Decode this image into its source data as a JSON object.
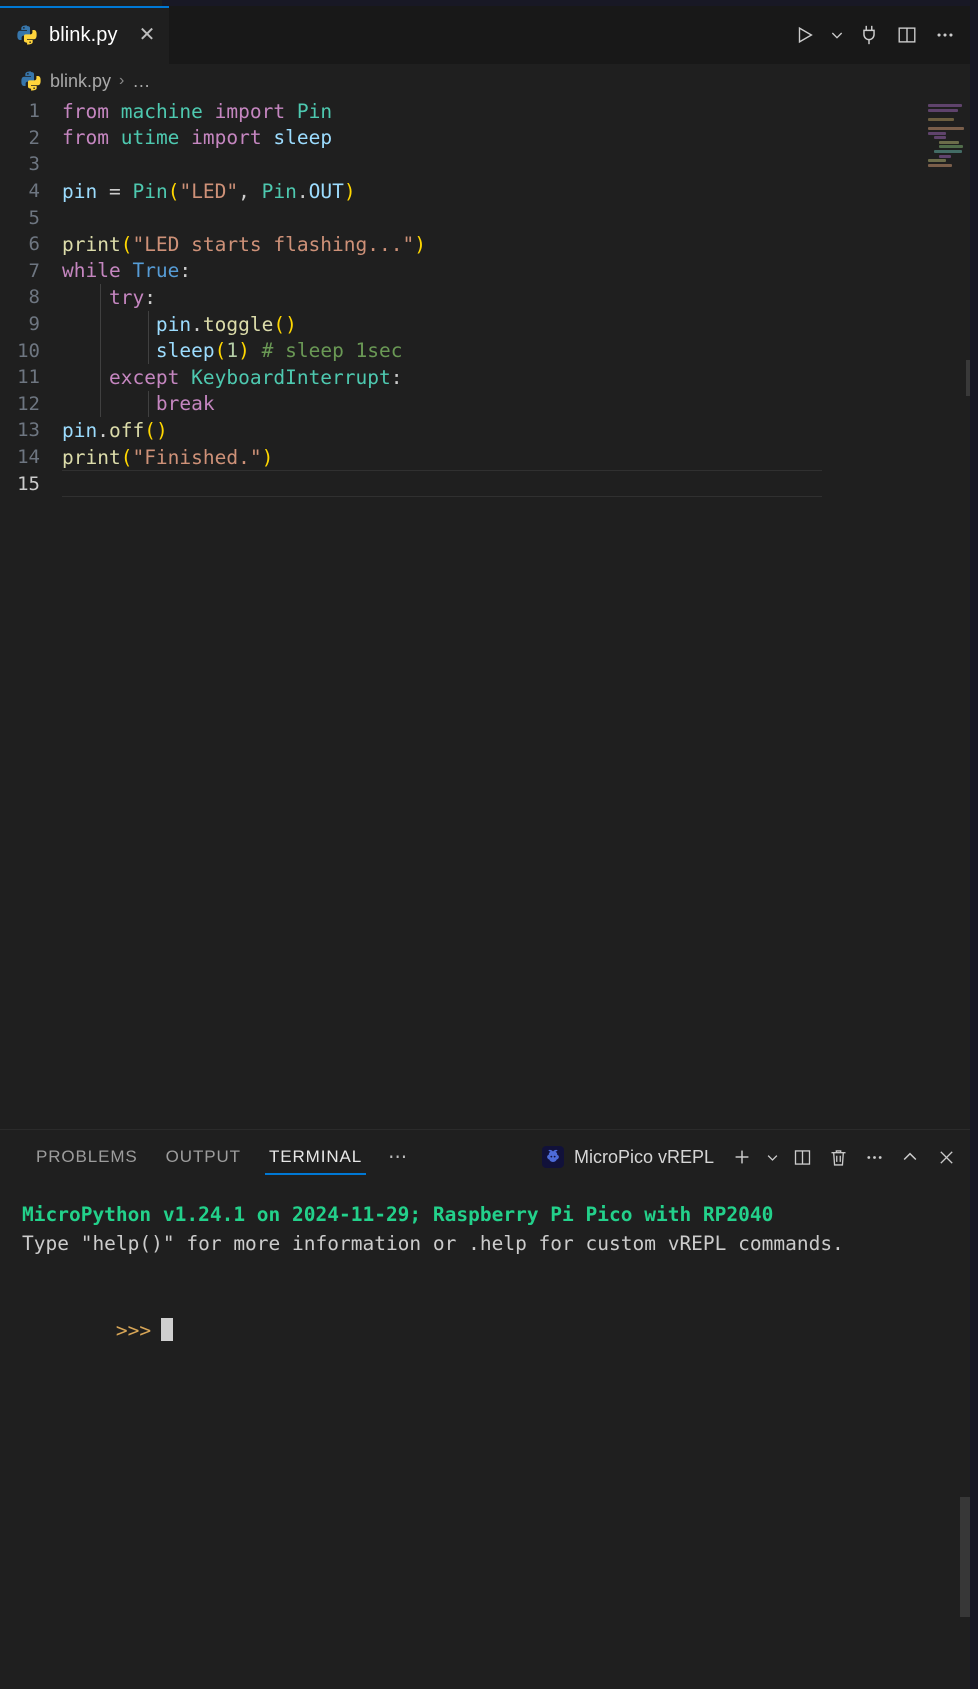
{
  "window": {
    "tab": {
      "title": "blink.py",
      "icon": "python-icon",
      "close_icon": "close-icon"
    },
    "actions": [
      {
        "name": "run-python-file-button",
        "icon": "play-icon",
        "label": "Run Python File"
      },
      {
        "name": "run-options-chevron",
        "icon": "chevron-down-icon",
        "label": ""
      },
      {
        "name": "micropico-connect-button",
        "icon": "plug-icon",
        "label": ""
      },
      {
        "name": "split-editor-button",
        "icon": "split-editor-icon",
        "label": ""
      },
      {
        "name": "more-actions-button",
        "icon": "ellipsis-icon",
        "label": "⋯"
      }
    ]
  },
  "breadcrumb": {
    "file": "blink.py",
    "separator": "›",
    "overflow": "…"
  },
  "editor": {
    "language": "python",
    "total_lines": 15,
    "current_line": 15,
    "lines": [
      {
        "n": "1",
        "tokens": [
          {
            "t": "from",
            "c": "kw"
          },
          {
            "t": " ",
            "c": "pun"
          },
          {
            "t": "machine",
            "c": "cls"
          },
          {
            "t": " ",
            "c": "pun"
          },
          {
            "t": "import",
            "c": "kw"
          },
          {
            "t": " ",
            "c": "pun"
          },
          {
            "t": "Pin",
            "c": "cls"
          }
        ]
      },
      {
        "n": "2",
        "tokens": [
          {
            "t": "from",
            "c": "kw"
          },
          {
            "t": " ",
            "c": "pun"
          },
          {
            "t": "utime",
            "c": "cls"
          },
          {
            "t": " ",
            "c": "pun"
          },
          {
            "t": "import",
            "c": "kw"
          },
          {
            "t": " ",
            "c": "pun"
          },
          {
            "t": "sleep",
            "c": "var"
          }
        ]
      },
      {
        "n": "3",
        "tokens": []
      },
      {
        "n": "4",
        "tokens": [
          {
            "t": "pin",
            "c": "var"
          },
          {
            "t": " = ",
            "c": "op"
          },
          {
            "t": "Pin",
            "c": "cls"
          },
          {
            "t": "(",
            "c": "br1"
          },
          {
            "t": "\"LED\"",
            "c": "str"
          },
          {
            "t": ", ",
            "c": "pun"
          },
          {
            "t": "Pin",
            "c": "cls"
          },
          {
            "t": ".",
            "c": "pun"
          },
          {
            "t": "OUT",
            "c": "var"
          },
          {
            "t": ")",
            "c": "br1"
          }
        ]
      },
      {
        "n": "5",
        "tokens": []
      },
      {
        "n": "6",
        "tokens": [
          {
            "t": "print",
            "c": "fn"
          },
          {
            "t": "(",
            "c": "br1"
          },
          {
            "t": "\"LED starts flashing...\"",
            "c": "str"
          },
          {
            "t": ")",
            "c": "br1"
          }
        ]
      },
      {
        "n": "7",
        "tokens": [
          {
            "t": "while",
            "c": "kw"
          },
          {
            "t": " ",
            "c": "pun"
          },
          {
            "t": "True",
            "c": "kw2"
          },
          {
            "t": ":",
            "c": "pun"
          }
        ]
      },
      {
        "n": "8",
        "tokens": [
          {
            "t": "    ",
            "c": "pun"
          },
          {
            "t": "try",
            "c": "kw"
          },
          {
            "t": ":",
            "c": "pun"
          }
        ]
      },
      {
        "n": "9",
        "tokens": [
          {
            "t": "        ",
            "c": "pun"
          },
          {
            "t": "pin",
            "c": "var"
          },
          {
            "t": ".",
            "c": "pun"
          },
          {
            "t": "toggle",
            "c": "fn"
          },
          {
            "t": "()",
            "c": "br1"
          }
        ]
      },
      {
        "n": "10",
        "tokens": [
          {
            "t": "        ",
            "c": "pun"
          },
          {
            "t": "sleep",
            "c": "var"
          },
          {
            "t": "(",
            "c": "br1"
          },
          {
            "t": "1",
            "c": "num"
          },
          {
            "t": ")",
            "c": "br1"
          },
          {
            "t": " ",
            "c": "pun"
          },
          {
            "t": "# sleep 1sec",
            "c": "cmt"
          }
        ]
      },
      {
        "n": "11",
        "tokens": [
          {
            "t": "    ",
            "c": "pun"
          },
          {
            "t": "except",
            "c": "kw"
          },
          {
            "t": " ",
            "c": "pun"
          },
          {
            "t": "KeyboardInterrupt",
            "c": "cls"
          },
          {
            "t": ":",
            "c": "pun"
          }
        ]
      },
      {
        "n": "12",
        "tokens": [
          {
            "t": "        ",
            "c": "pun"
          },
          {
            "t": "break",
            "c": "kw"
          }
        ]
      },
      {
        "n": "13",
        "tokens": [
          {
            "t": "pin",
            "c": "var"
          },
          {
            "t": ".",
            "c": "pun"
          },
          {
            "t": "off",
            "c": "fn"
          },
          {
            "t": "()",
            "c": "br1"
          }
        ]
      },
      {
        "n": "14",
        "tokens": [
          {
            "t": "print",
            "c": "fn"
          },
          {
            "t": "(",
            "c": "br1"
          },
          {
            "t": "\"Finished.\"",
            "c": "str"
          },
          {
            "t": ")",
            "c": "br1"
          }
        ]
      },
      {
        "n": "15",
        "tokens": []
      }
    ]
  },
  "panel": {
    "tabs": [
      {
        "label": "PROBLEMS",
        "active": false
      },
      {
        "label": "OUTPUT",
        "active": false
      },
      {
        "label": "TERMINAL",
        "active": true
      }
    ],
    "overflow": "⋯",
    "terminal_selector": {
      "label": "MicroPico vREPL",
      "icon": "raspberry-pi-icon"
    },
    "actions": [
      {
        "name": "new-terminal-button",
        "icon": "plus-icon"
      },
      {
        "name": "terminal-profile-chevron",
        "icon": "chevron-down-icon"
      },
      {
        "name": "split-terminal-button",
        "icon": "split-editor-icon"
      },
      {
        "name": "kill-terminal-button",
        "icon": "trash-icon"
      },
      {
        "name": "terminal-more-button",
        "icon": "ellipsis-icon"
      },
      {
        "name": "maximize-panel-button",
        "icon": "chevron-up-icon"
      },
      {
        "name": "close-panel-button",
        "icon": "close-icon"
      }
    ]
  },
  "terminal": {
    "banner": "MicroPython v1.24.1 on 2024-11-29; Raspberry Pi Pico with RP2040",
    "help": "Type \"help()\" for more information or .help for custom vREPL commands.",
    "prompt": ">>>",
    "input_value": ""
  },
  "colors": {
    "accent": "#0078d4",
    "editor_bg": "#1f1f1f",
    "tabbar_bg": "#181818",
    "terminal_green": "#23d18b",
    "terminal_prompt": "#d8a657"
  }
}
